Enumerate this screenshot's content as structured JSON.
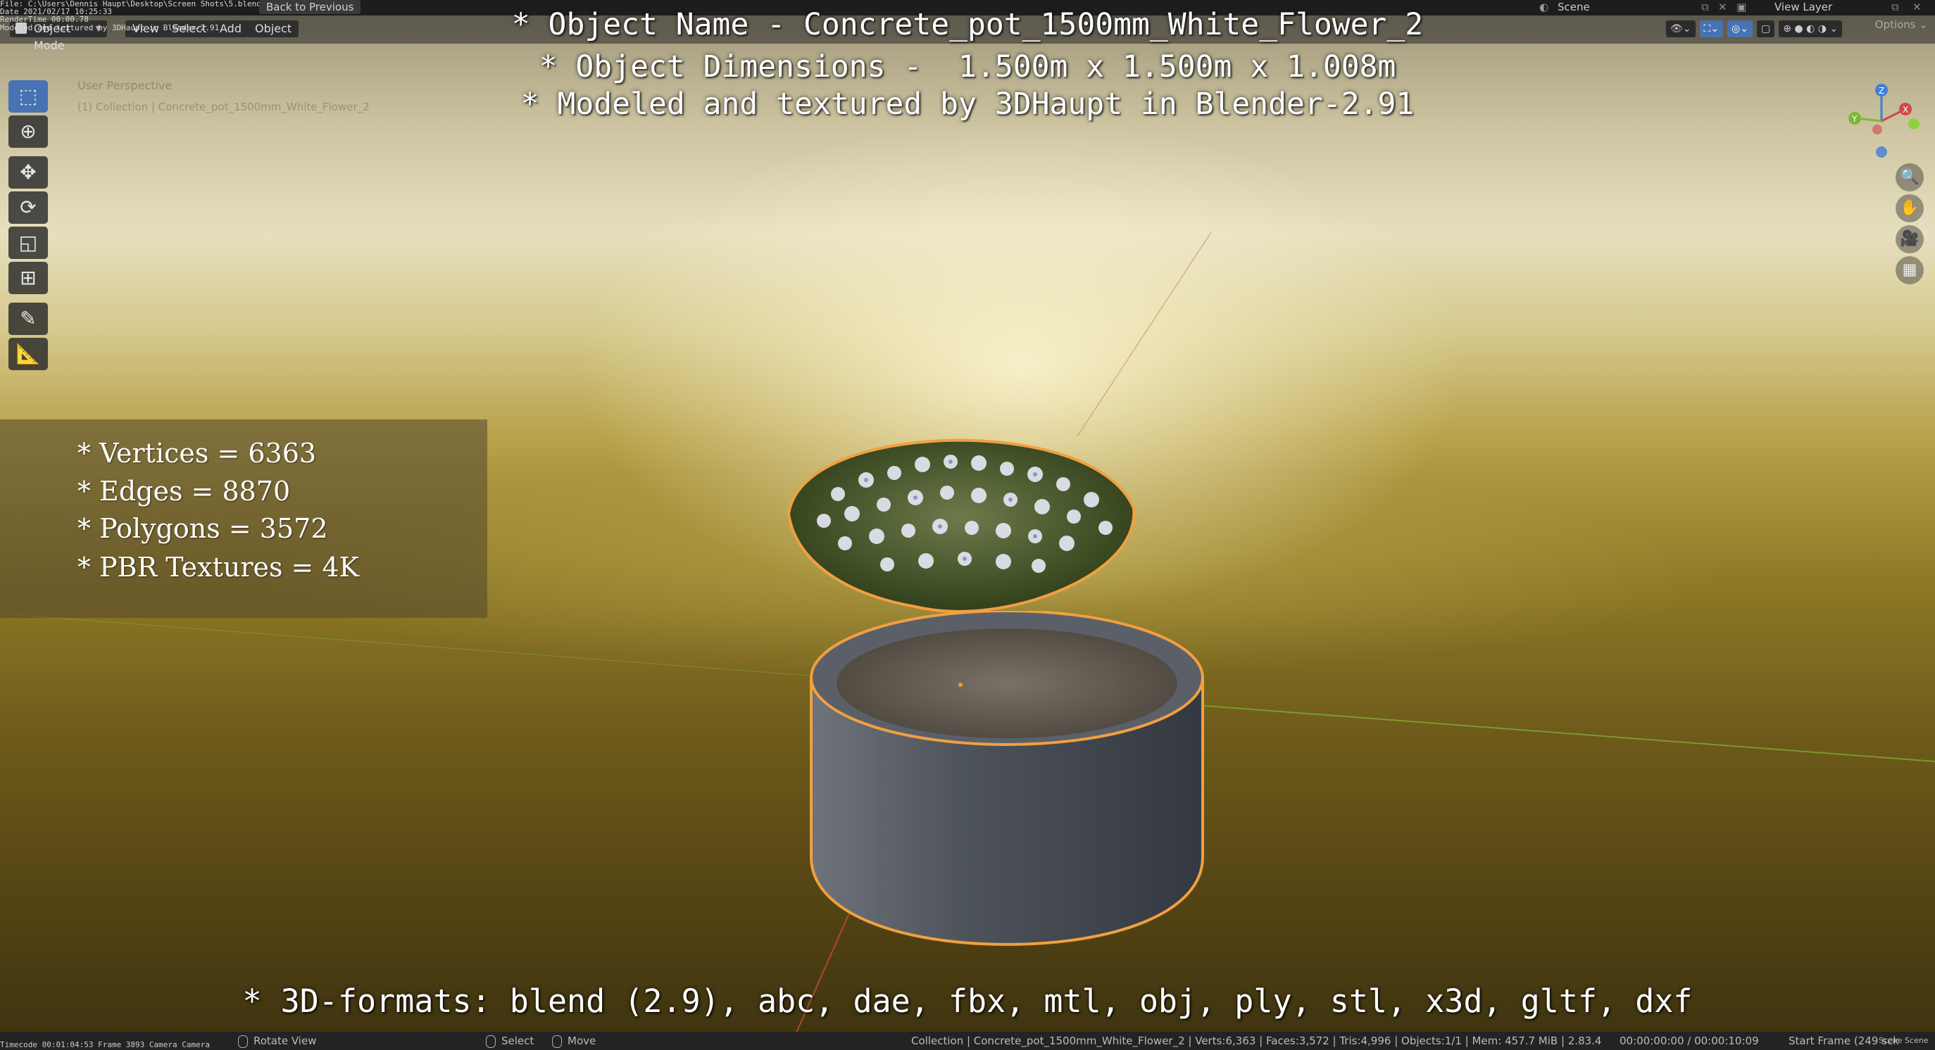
{
  "topbar": {
    "info_lines": [
      "File: C:\\Users\\Dennis Haupt\\Desktop\\Screen Shots\\5.blend",
      "Date 2021/02/17 10:25:33",
      "RenderTime 00:00.78",
      "Modeled and textured by 3DHaupt in Blender-2.91"
    ],
    "back_label": "Back to Previous",
    "scene_label": "Scene",
    "view_layer_label": "View Layer"
  },
  "header": {
    "mode_label": "Object Mode",
    "menus": [
      "View",
      "Select",
      "Add",
      "Object"
    ],
    "options_label": "Options"
  },
  "overlay": {
    "line1": "* Object Name - Concrete_pot_1500mm_White_Flower_2",
    "line2": "* Object Dimensions -  1.500m x 1.500m x 1.008m",
    "line3": "* Modeled and textured by 3DHaupt in Blender-2.91",
    "perspective": "User Perspective",
    "collection": "(1) Collection | Concrete_pot_1500mm_White_Flower_2"
  },
  "stats": {
    "vertices": "* Vertices = 6363",
    "edges": "* Edges = 8870",
    "polygons": "* Polygons = 3572",
    "textures": "* PBR Textures = 4K"
  },
  "formats": "* 3D-formats: blend (2.9), abc, dae, fbx, mtl, obj, ply, stl, x3d, gltf, dxf",
  "statusbar": {
    "timecode": "Timecode 00:01:04:53  Frame 3893  Camera Camera",
    "rotate_label": "Rotate View",
    "select_label": "Select",
    "move_label": "Move",
    "scene_info": "Collection | Concrete_pot_1500mm_White_Flower_2 | Verts:6,363 | Faces:3,572 | Tris:4,996 | Objects:1/1 | Mem: 457.7 MiB | 2.83.4",
    "time_info": "00:00:00:00 / 00:00:10:09",
    "start_frame": "Start Frame (249 sck",
    "scene_right": "Scene Scene"
  },
  "gizmo": {
    "z": "Z",
    "x": "X",
    "y": "Y"
  },
  "colors": {
    "accent": "#4772b3",
    "selection_outline": "#f0a040",
    "x_axis": "#d24848",
    "y_axis": "#7fb53a",
    "z_axis": "#3f7fd6"
  },
  "icons": {
    "tools": [
      "select-box-icon",
      "cursor-icon",
      "move-icon",
      "rotate-icon",
      "scale-icon",
      "transform-icon",
      "annotate-icon",
      "measure-icon"
    ],
    "nav": [
      "zoom-icon",
      "pan-hand-icon",
      "camera-icon",
      "grid-icon"
    ]
  }
}
